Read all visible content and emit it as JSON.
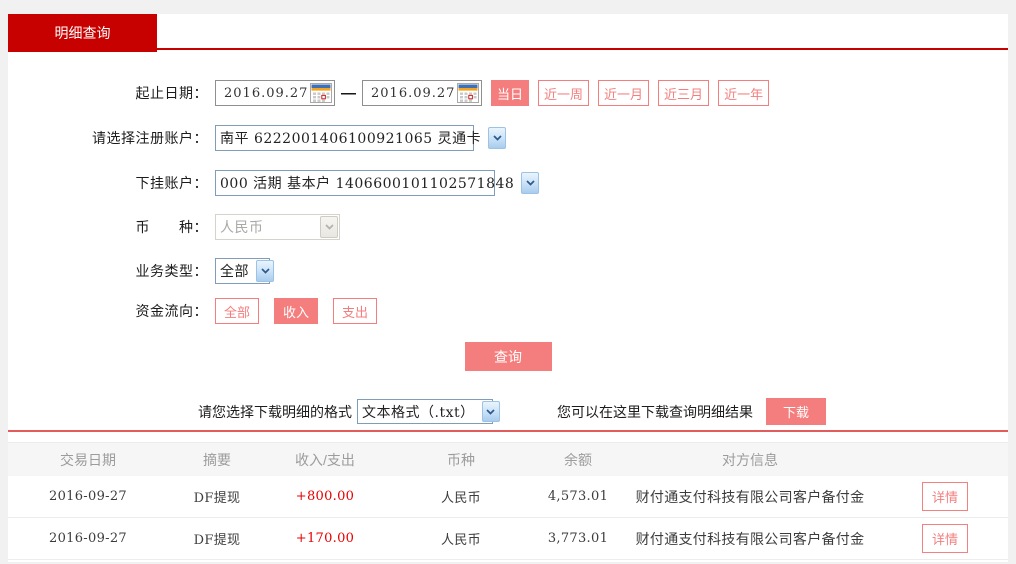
{
  "tab": {
    "title": "明细查询"
  },
  "form": {
    "date": {
      "label": "起止日期：",
      "from": "2016.09.27",
      "to": "2016.09.27",
      "separator": "—"
    },
    "quick_ranges": [
      {
        "label": "当日",
        "active": true
      },
      {
        "label": "近一周",
        "active": false
      },
      {
        "label": "近一月",
        "active": false
      },
      {
        "label": "近三月",
        "active": false
      },
      {
        "label": "近一年",
        "active": false
      }
    ],
    "register_account": {
      "label": "请选择注册账户：",
      "value": "南平 6222001406100921065 灵通卡"
    },
    "sub_account": {
      "label": "下挂账户：",
      "value": "000 活期 基本户 1406600101102571848"
    },
    "currency": {
      "label": "币　　种：",
      "value": "人民币",
      "disabled": true
    },
    "business_type": {
      "label": "业务类型：",
      "value": "全部"
    },
    "flow": {
      "label": "资金流向：",
      "options": [
        {
          "label": "全部",
          "active": false
        },
        {
          "label": "收入",
          "active": true
        },
        {
          "label": "支出",
          "active": false
        }
      ]
    },
    "query_button": "查询"
  },
  "download": {
    "format_label": "请您选择下载明细的格式",
    "format_value": "文本格式（.txt）",
    "hint": "您可以在这里下载查询明细结果",
    "button": "下载"
  },
  "table": {
    "headers": [
      "交易日期",
      "摘要",
      "收入/支出",
      "币种",
      "余额",
      "对方信息"
    ],
    "rows": [
      {
        "date": "2016-09-27",
        "summary": "DF提现",
        "amount": "+800.00",
        "currency": "人民币",
        "balance": "4,573.01",
        "counterparty": "财付通支付科技有限公司客户备付金",
        "action": "详情"
      },
      {
        "date": "2016-09-27",
        "summary": "DF提现",
        "amount": "+170.00",
        "currency": "人民币",
        "balance": "3,773.01",
        "counterparty": "财付通支付科技有限公司客户备付金",
        "action": "详情"
      }
    ]
  },
  "colors": {
    "accent_red": "#c70000",
    "salmon": "#f47e7e",
    "amount_red": "#e60000",
    "divider_pink": "#e25c5c"
  }
}
